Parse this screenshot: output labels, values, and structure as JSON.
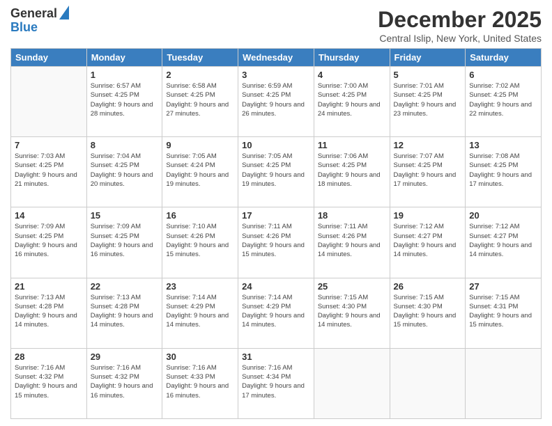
{
  "logo": {
    "general": "General",
    "blue": "Blue"
  },
  "header": {
    "month": "December 2025",
    "location": "Central Islip, New York, United States"
  },
  "weekdays": [
    "Sunday",
    "Monday",
    "Tuesday",
    "Wednesday",
    "Thursday",
    "Friday",
    "Saturday"
  ],
  "weeks": [
    [
      {
        "day": "",
        "sunrise": "",
        "sunset": "",
        "daylight": ""
      },
      {
        "day": "1",
        "sunrise": "Sunrise: 6:57 AM",
        "sunset": "Sunset: 4:25 PM",
        "daylight": "Daylight: 9 hours and 28 minutes."
      },
      {
        "day": "2",
        "sunrise": "Sunrise: 6:58 AM",
        "sunset": "Sunset: 4:25 PM",
        "daylight": "Daylight: 9 hours and 27 minutes."
      },
      {
        "day": "3",
        "sunrise": "Sunrise: 6:59 AM",
        "sunset": "Sunset: 4:25 PM",
        "daylight": "Daylight: 9 hours and 26 minutes."
      },
      {
        "day": "4",
        "sunrise": "Sunrise: 7:00 AM",
        "sunset": "Sunset: 4:25 PM",
        "daylight": "Daylight: 9 hours and 24 minutes."
      },
      {
        "day": "5",
        "sunrise": "Sunrise: 7:01 AM",
        "sunset": "Sunset: 4:25 PM",
        "daylight": "Daylight: 9 hours and 23 minutes."
      },
      {
        "day": "6",
        "sunrise": "Sunrise: 7:02 AM",
        "sunset": "Sunset: 4:25 PM",
        "daylight": "Daylight: 9 hours and 22 minutes."
      }
    ],
    [
      {
        "day": "7",
        "sunrise": "Sunrise: 7:03 AM",
        "sunset": "Sunset: 4:25 PM",
        "daylight": "Daylight: 9 hours and 21 minutes."
      },
      {
        "day": "8",
        "sunrise": "Sunrise: 7:04 AM",
        "sunset": "Sunset: 4:25 PM",
        "daylight": "Daylight: 9 hours and 20 minutes."
      },
      {
        "day": "9",
        "sunrise": "Sunrise: 7:05 AM",
        "sunset": "Sunset: 4:24 PM",
        "daylight": "Daylight: 9 hours and 19 minutes."
      },
      {
        "day": "10",
        "sunrise": "Sunrise: 7:05 AM",
        "sunset": "Sunset: 4:25 PM",
        "daylight": "Daylight: 9 hours and 19 minutes."
      },
      {
        "day": "11",
        "sunrise": "Sunrise: 7:06 AM",
        "sunset": "Sunset: 4:25 PM",
        "daylight": "Daylight: 9 hours and 18 minutes."
      },
      {
        "day": "12",
        "sunrise": "Sunrise: 7:07 AM",
        "sunset": "Sunset: 4:25 PM",
        "daylight": "Daylight: 9 hours and 17 minutes."
      },
      {
        "day": "13",
        "sunrise": "Sunrise: 7:08 AM",
        "sunset": "Sunset: 4:25 PM",
        "daylight": "Daylight: 9 hours and 17 minutes."
      }
    ],
    [
      {
        "day": "14",
        "sunrise": "Sunrise: 7:09 AM",
        "sunset": "Sunset: 4:25 PM",
        "daylight": "Daylight: 9 hours and 16 minutes."
      },
      {
        "day": "15",
        "sunrise": "Sunrise: 7:09 AM",
        "sunset": "Sunset: 4:25 PM",
        "daylight": "Daylight: 9 hours and 16 minutes."
      },
      {
        "day": "16",
        "sunrise": "Sunrise: 7:10 AM",
        "sunset": "Sunset: 4:26 PM",
        "daylight": "Daylight: 9 hours and 15 minutes."
      },
      {
        "day": "17",
        "sunrise": "Sunrise: 7:11 AM",
        "sunset": "Sunset: 4:26 PM",
        "daylight": "Daylight: 9 hours and 15 minutes."
      },
      {
        "day": "18",
        "sunrise": "Sunrise: 7:11 AM",
        "sunset": "Sunset: 4:26 PM",
        "daylight": "Daylight: 9 hours and 14 minutes."
      },
      {
        "day": "19",
        "sunrise": "Sunrise: 7:12 AM",
        "sunset": "Sunset: 4:27 PM",
        "daylight": "Daylight: 9 hours and 14 minutes."
      },
      {
        "day": "20",
        "sunrise": "Sunrise: 7:12 AM",
        "sunset": "Sunset: 4:27 PM",
        "daylight": "Daylight: 9 hours and 14 minutes."
      }
    ],
    [
      {
        "day": "21",
        "sunrise": "Sunrise: 7:13 AM",
        "sunset": "Sunset: 4:28 PM",
        "daylight": "Daylight: 9 hours and 14 minutes."
      },
      {
        "day": "22",
        "sunrise": "Sunrise: 7:13 AM",
        "sunset": "Sunset: 4:28 PM",
        "daylight": "Daylight: 9 hours and 14 minutes."
      },
      {
        "day": "23",
        "sunrise": "Sunrise: 7:14 AM",
        "sunset": "Sunset: 4:29 PM",
        "daylight": "Daylight: 9 hours and 14 minutes."
      },
      {
        "day": "24",
        "sunrise": "Sunrise: 7:14 AM",
        "sunset": "Sunset: 4:29 PM",
        "daylight": "Daylight: 9 hours and 14 minutes."
      },
      {
        "day": "25",
        "sunrise": "Sunrise: 7:15 AM",
        "sunset": "Sunset: 4:30 PM",
        "daylight": "Daylight: 9 hours and 14 minutes."
      },
      {
        "day": "26",
        "sunrise": "Sunrise: 7:15 AM",
        "sunset": "Sunset: 4:30 PM",
        "daylight": "Daylight: 9 hours and 15 minutes."
      },
      {
        "day": "27",
        "sunrise": "Sunrise: 7:15 AM",
        "sunset": "Sunset: 4:31 PM",
        "daylight": "Daylight: 9 hours and 15 minutes."
      }
    ],
    [
      {
        "day": "28",
        "sunrise": "Sunrise: 7:16 AM",
        "sunset": "Sunset: 4:32 PM",
        "daylight": "Daylight: 9 hours and 15 minutes."
      },
      {
        "day": "29",
        "sunrise": "Sunrise: 7:16 AM",
        "sunset": "Sunset: 4:32 PM",
        "daylight": "Daylight: 9 hours and 16 minutes."
      },
      {
        "day": "30",
        "sunrise": "Sunrise: 7:16 AM",
        "sunset": "Sunset: 4:33 PM",
        "daylight": "Daylight: 9 hours and 16 minutes."
      },
      {
        "day": "31",
        "sunrise": "Sunrise: 7:16 AM",
        "sunset": "Sunset: 4:34 PM",
        "daylight": "Daylight: 9 hours and 17 minutes."
      },
      {
        "day": "",
        "sunrise": "",
        "sunset": "",
        "daylight": ""
      },
      {
        "day": "",
        "sunrise": "",
        "sunset": "",
        "daylight": ""
      },
      {
        "day": "",
        "sunrise": "",
        "sunset": "",
        "daylight": ""
      }
    ]
  ]
}
